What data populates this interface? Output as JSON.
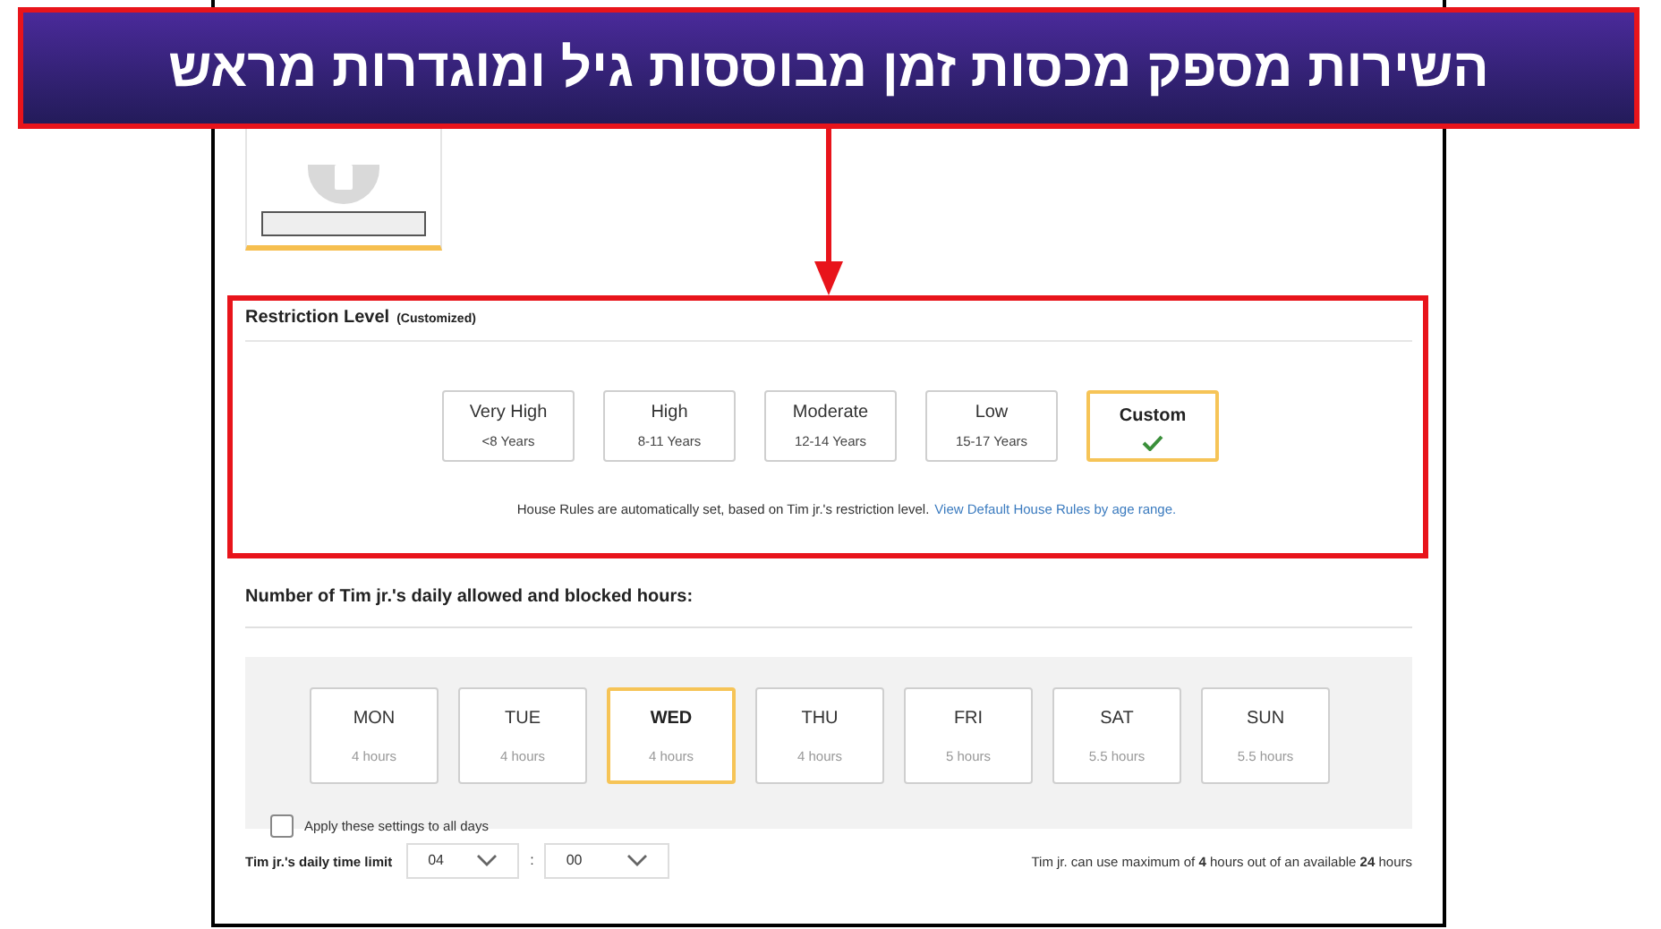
{
  "banner": {
    "text": "השירות מספק מכסות זמן מבוססות גיל ומוגדרות מראש"
  },
  "restriction": {
    "title": "Restriction Level",
    "subtitle": "(Customized)",
    "levels": [
      {
        "name": "Very High",
        "ages": "<8 Years",
        "selected": false
      },
      {
        "name": "High",
        "ages": "8-11 Years",
        "selected": false
      },
      {
        "name": "Moderate",
        "ages": "12-14 Years",
        "selected": false
      },
      {
        "name": "Low",
        "ages": "15-17 Years",
        "selected": false
      },
      {
        "name": "Custom",
        "selected": true
      }
    ],
    "note": "House Rules are automatically set, based on Tim jr.'s restriction level.",
    "link": "View Default House Rules by age range."
  },
  "hours": {
    "title": "Number of Tim jr.'s daily allowed and blocked hours:",
    "days": [
      {
        "name": "MON",
        "hours": "4 hours",
        "selected": false
      },
      {
        "name": "TUE",
        "hours": "4 hours",
        "selected": false
      },
      {
        "name": "WED",
        "hours": "4 hours",
        "selected": true
      },
      {
        "name": "THU",
        "hours": "4 hours",
        "selected": false
      },
      {
        "name": "FRI",
        "hours": "5 hours",
        "selected": false
      },
      {
        "name": "SAT",
        "hours": "5.5 hours",
        "selected": false
      },
      {
        "name": "SUN",
        "hours": "5.5 hours",
        "selected": false
      }
    ],
    "apply_all": {
      "label": "Apply these settings to all days",
      "checked": false
    }
  },
  "time_limit": {
    "label": "Tim jr.'s daily time limit",
    "hours": "04",
    "separator": ":",
    "minutes": "00",
    "summary": "Tim jr. can use maximum of **4** hours out of an available **24** hours"
  }
}
